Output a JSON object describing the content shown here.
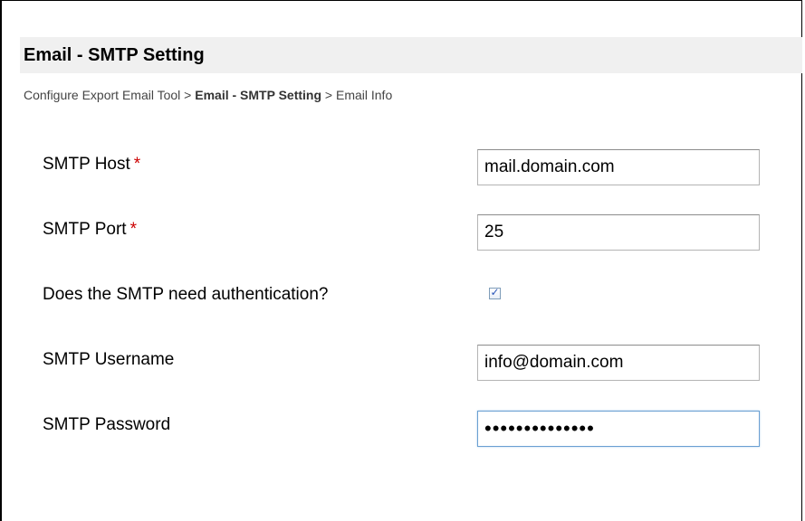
{
  "header": {
    "title": "Email - SMTP Setting"
  },
  "breadcrumb": {
    "items": [
      "Configure Export Email Tool",
      "Email - SMTP Setting",
      "Email Info"
    ],
    "separator": ">"
  },
  "form": {
    "required_marker": "*",
    "host": {
      "label": "SMTP Host",
      "value": "mail.domain.com"
    },
    "port": {
      "label": "SMTP Port",
      "value": "25"
    },
    "auth": {
      "label": "Does the SMTP need authentication?",
      "checked": true,
      "mark": "✓"
    },
    "username": {
      "label": "SMTP Username",
      "value": "info@domain.com"
    },
    "password": {
      "label": "SMTP Password",
      "value": "••••••••••••••"
    }
  },
  "colors": {
    "header_bg": "#f0f0f0",
    "required": "#cc0000",
    "focus_border": "#6a9fd2"
  }
}
